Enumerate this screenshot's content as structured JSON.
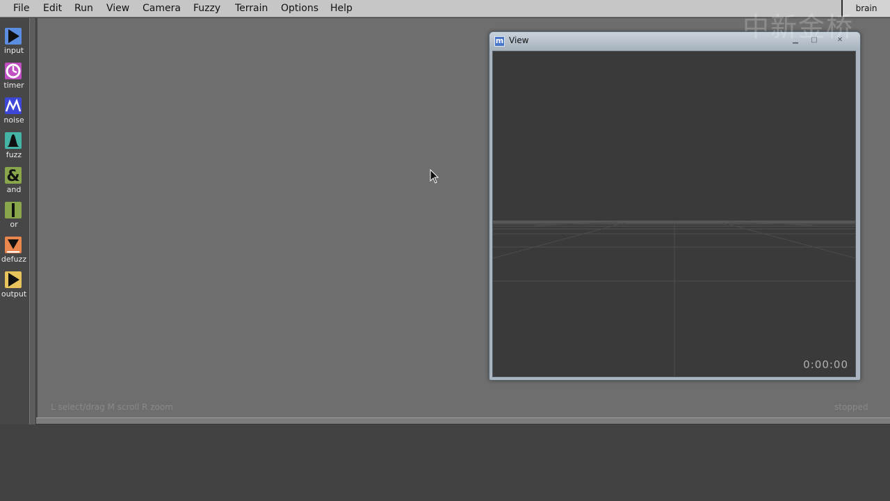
{
  "menubar": {
    "items": [
      "File",
      "Edit",
      "Run",
      "View",
      "Camera",
      "Fuzzy",
      "Terrain",
      "Options",
      "Help"
    ],
    "tab_label": "brain"
  },
  "toolbar": {
    "tools": [
      {
        "label": "input",
        "icon": "play-arrow-icon",
        "color": "#5b8de0"
      },
      {
        "label": "timer",
        "icon": "clock-icon",
        "color": "#c04fc4"
      },
      {
        "label": "noise",
        "icon": "noise-wave-icon",
        "color": "#3d46d6"
      },
      {
        "label": "fuzz",
        "icon": "bell-curve-icon",
        "color": "#45b4a6"
      },
      {
        "label": "and",
        "icon": "ampersand-icon",
        "color": "#8aa64c"
      },
      {
        "label": "or",
        "icon": "bar-icon",
        "color": "#8aa64c"
      },
      {
        "label": "defuzz",
        "icon": "down-triangle-icon",
        "color": "#e9874f"
      },
      {
        "label": "output",
        "icon": "play-arrow-icon",
        "color": "#e8c25a"
      }
    ]
  },
  "canvas": {
    "hint": "L  select/drag   M  scroll   R  zoom",
    "status": "stopped"
  },
  "view_window": {
    "title": "View",
    "app_icon_letter": "m",
    "clock": "0:00:00"
  },
  "watermark": "中新金桥",
  "colors": {
    "menubar": "#c6c6c6",
    "canvas": "#6e6e6e",
    "background": "#424242",
    "viewport": "#3a3a3a"
  }
}
